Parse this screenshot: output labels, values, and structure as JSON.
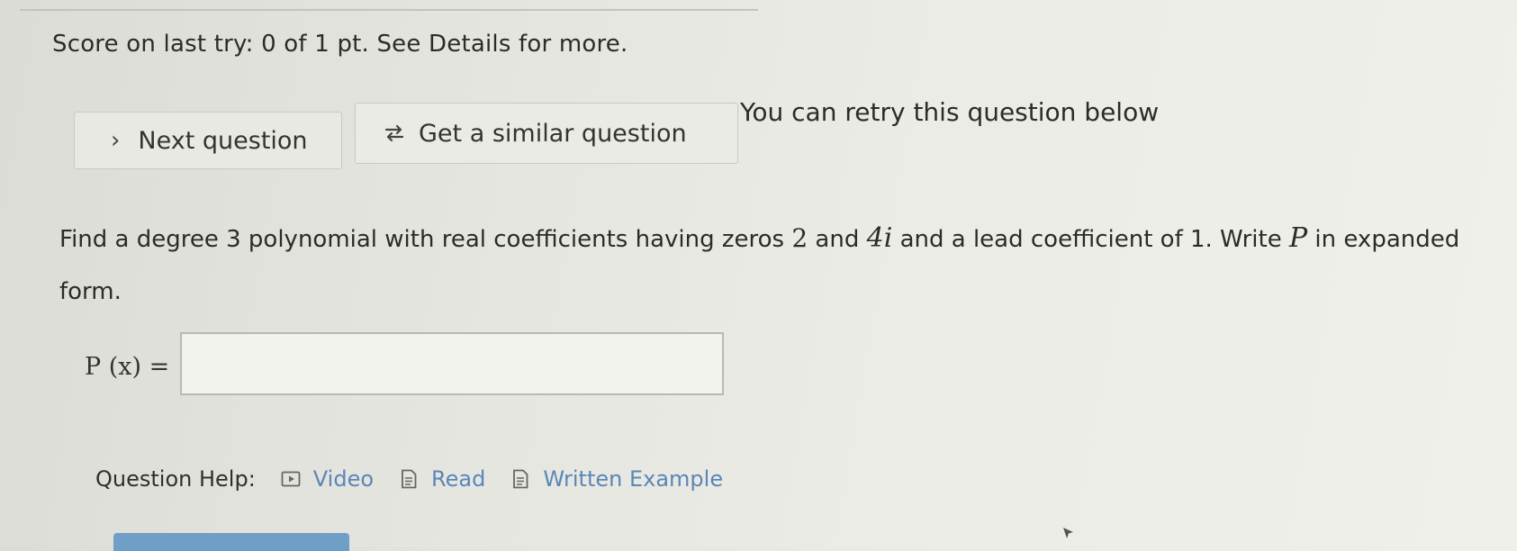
{
  "score": {
    "text": "Score on last try: 0 of 1 pt. See Details for more."
  },
  "nav": {
    "next_label": "Next question",
    "similar_label": "Get a similar question",
    "retry_message": "You can retry this question below"
  },
  "question": {
    "text_1": "Find a degree 3 polynomial with real coefficients having zeros ",
    "zero_a": "2",
    "text_2": " and ",
    "zero_b": "4i",
    "text_3": " and a lead coefficient of 1. Write ",
    "var_p": "P",
    "text_4": " in expanded form."
  },
  "answer": {
    "label": "P (x) =",
    "value": "",
    "placeholder": ""
  },
  "help": {
    "label": "Question Help:",
    "links": [
      {
        "label": "Video",
        "icon": "play-icon"
      },
      {
        "label": "Read",
        "icon": "document-icon"
      },
      {
        "label": "Written Example",
        "icon": "document-icon"
      }
    ]
  },
  "colors": {
    "link": "#5b86b8",
    "bottom_button": "#6f9ec6"
  }
}
